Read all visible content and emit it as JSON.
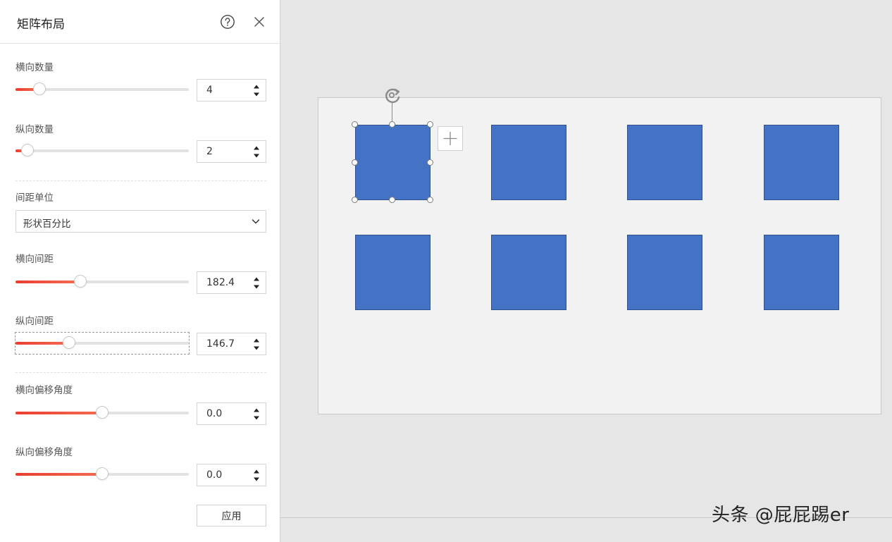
{
  "panel": {
    "title": "矩阵布局",
    "help_icon": "help-circle-icon",
    "close_icon": "close-icon",
    "h_count": {
      "label": "横向数量",
      "value": "4",
      "level": 0.14
    },
    "v_count": {
      "label": "纵向数量",
      "value": "2",
      "level": 0.07
    },
    "spacing_unit": {
      "label": "间距单位",
      "value": "形状百分比"
    },
    "h_spacing": {
      "label": "横向间距",
      "value": "182.4",
      "level": 0.375
    },
    "v_spacing": {
      "label": "纵向间距",
      "value": "146.7",
      "level": 0.31
    },
    "h_offset": {
      "label": "横向偏移角度",
      "value": "0.0",
      "level": 0.5
    },
    "v_offset": {
      "label": "纵向偏移角度",
      "value": "0.0",
      "level": 0.5
    },
    "apply_label": "应用"
  },
  "canvas": {
    "grid": {
      "columns": 4,
      "rows": 2
    },
    "shape_color": "#4472c4",
    "selected_index": 0,
    "rotate_icon": "rotate-handle-icon",
    "add_icon": "plus-icon"
  },
  "accent_color": "#ec3d2f",
  "watermark": "头条 @屁屁踢er"
}
